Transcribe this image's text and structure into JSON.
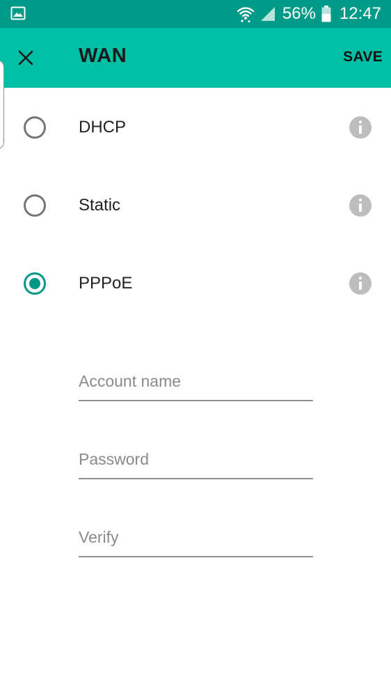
{
  "status_bar": {
    "battery_text": "56%",
    "time": "12:47",
    "icons": [
      "gallery-icon",
      "wifi-icon",
      "signal-icon",
      "battery-icon"
    ]
  },
  "app_bar": {
    "title": "WAN",
    "save_label": "SAVE",
    "close_icon": "close-icon"
  },
  "options": [
    {
      "label": "DHCP",
      "selected": false,
      "info_icon": "info-icon"
    },
    {
      "label": "Static",
      "selected": false,
      "info_icon": "info-icon"
    },
    {
      "label": "PPPoE",
      "selected": true,
      "info_icon": "info-icon"
    }
  ],
  "pppoe_form": {
    "account_name": {
      "value": "",
      "placeholder": "Account name"
    },
    "password": {
      "value": "",
      "placeholder": "Password"
    },
    "verify": {
      "value": "",
      "placeholder": "Verify"
    }
  },
  "colors": {
    "status_bar": "#009a88",
    "app_bar": "#00bfa5",
    "accent": "#009688",
    "info_icon": "#bdbdbd"
  }
}
